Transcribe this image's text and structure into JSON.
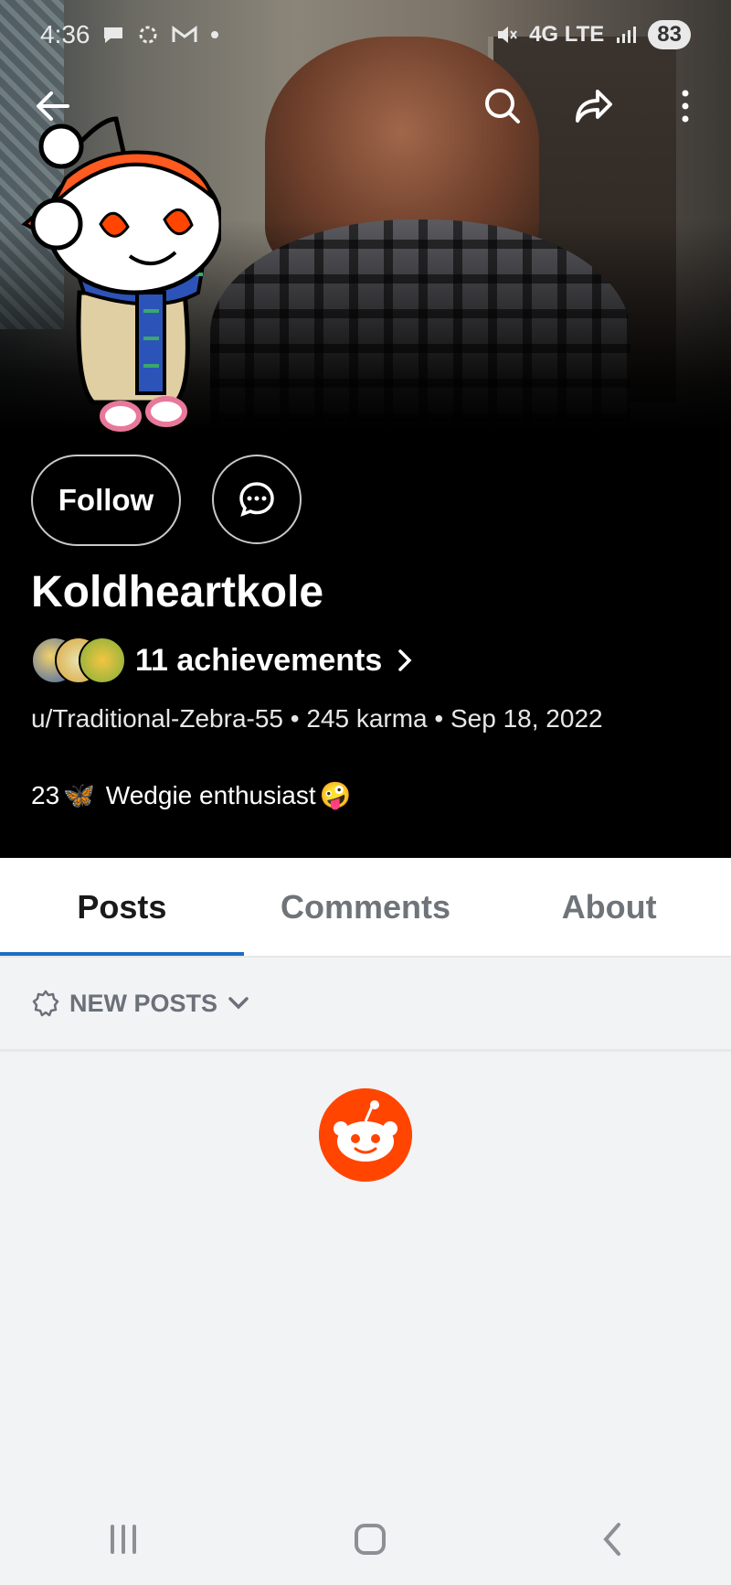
{
  "status_bar": {
    "time": "4:36",
    "network": "4G LTE",
    "battery": "83",
    "icons": [
      "chat-bubble-icon",
      "settings-spin-icon",
      "gmail-icon",
      "dot-icon",
      "mute-icon",
      "signal-icon"
    ]
  },
  "profile": {
    "display_name": "Koldheartkole",
    "follow_label": "Follow",
    "achievements_label": "11 achievements",
    "meta": "u/Traditional-Zebra-55 • 245 karma • Sep 18, 2022",
    "bio_prefix": "23",
    "bio_emoji_1": "🦋",
    "bio_text": " Wedgie enthusiast",
    "bio_emoji_2": "🤪"
  },
  "tabs": [
    {
      "label": "Posts",
      "active": true
    },
    {
      "label": "Comments",
      "active": false
    },
    {
      "label": "About",
      "active": false
    }
  ],
  "feed": {
    "sort_label": "NEW POSTS"
  },
  "colors": {
    "accent_tab": "#1a6fc2",
    "reddit_orange": "#ff4500",
    "feed_bg": "#f1f3f5"
  }
}
